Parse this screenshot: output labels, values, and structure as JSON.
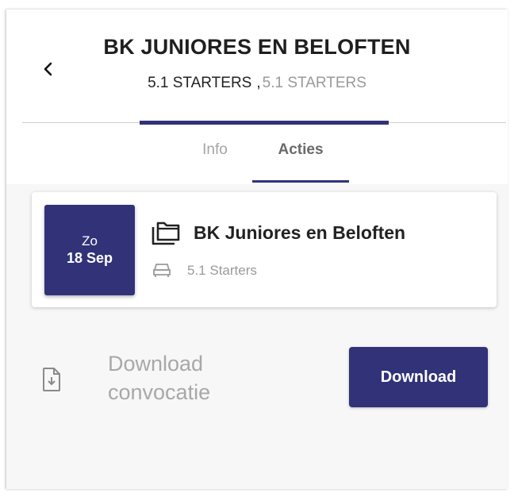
{
  "header": {
    "title": "BK JUNIORES EN BELOFTEN",
    "subtitle_primary": "5.1 STARTERS",
    "subtitle_separator": ",",
    "subtitle_secondary": "5.1 STARTERS"
  },
  "tabs": [
    {
      "label": "Info",
      "active": false
    },
    {
      "label": "Acties",
      "active": true
    }
  ],
  "event": {
    "day": "Zo",
    "date": "18 Sep",
    "title": "BK Juniores en Beloften",
    "team": "5.1 Starters",
    "title_icon": "folder-copy-icon",
    "team_icon": "team-bench-icon"
  },
  "download": {
    "label": "Download convocatie",
    "button_label": "Download",
    "icon": "file-download-icon"
  },
  "colors": {
    "accent": "#323279",
    "background": "#f7f7f7",
    "muted_text": "#9a9a9a"
  }
}
